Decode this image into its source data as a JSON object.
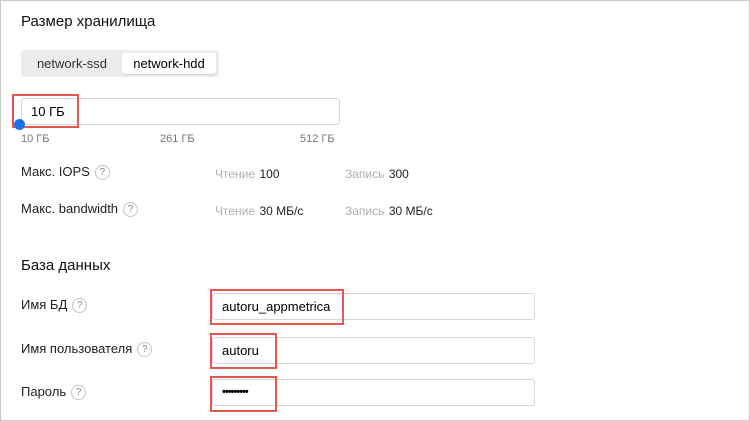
{
  "storage": {
    "title": "Размер хранилища",
    "tabs": [
      {
        "label": "network-ssd",
        "active": false
      },
      {
        "label": "network-hdd",
        "active": true
      }
    ],
    "size_value": "10 ГБ",
    "slider": {
      "level": 0,
      "min_label": "10 ГБ",
      "mid_label": "261 ГБ",
      "max_label": "512 ГБ"
    },
    "iops": {
      "label": "Макс. IOPS",
      "read_label": "Чтение",
      "read_value": "100",
      "write_label": "Запись",
      "write_value": "300"
    },
    "bandwidth": {
      "label": "Макс. bandwidth",
      "read_label": "Чтение",
      "read_value": "30 МБ/с",
      "write_label": "Запись",
      "write_value": "30 МБ/с"
    },
    "help_glyph": "?"
  },
  "database": {
    "title": "База данных",
    "db_name": {
      "label": "Имя БД",
      "value": "autoru_appmetrica"
    },
    "user": {
      "label": "Имя пользователя",
      "value": "autoru"
    },
    "password": {
      "label": "Пароль",
      "value": "•••••••••"
    }
  },
  "colors": {
    "accent": "#1a73e8",
    "highlight": "#e8574e"
  }
}
